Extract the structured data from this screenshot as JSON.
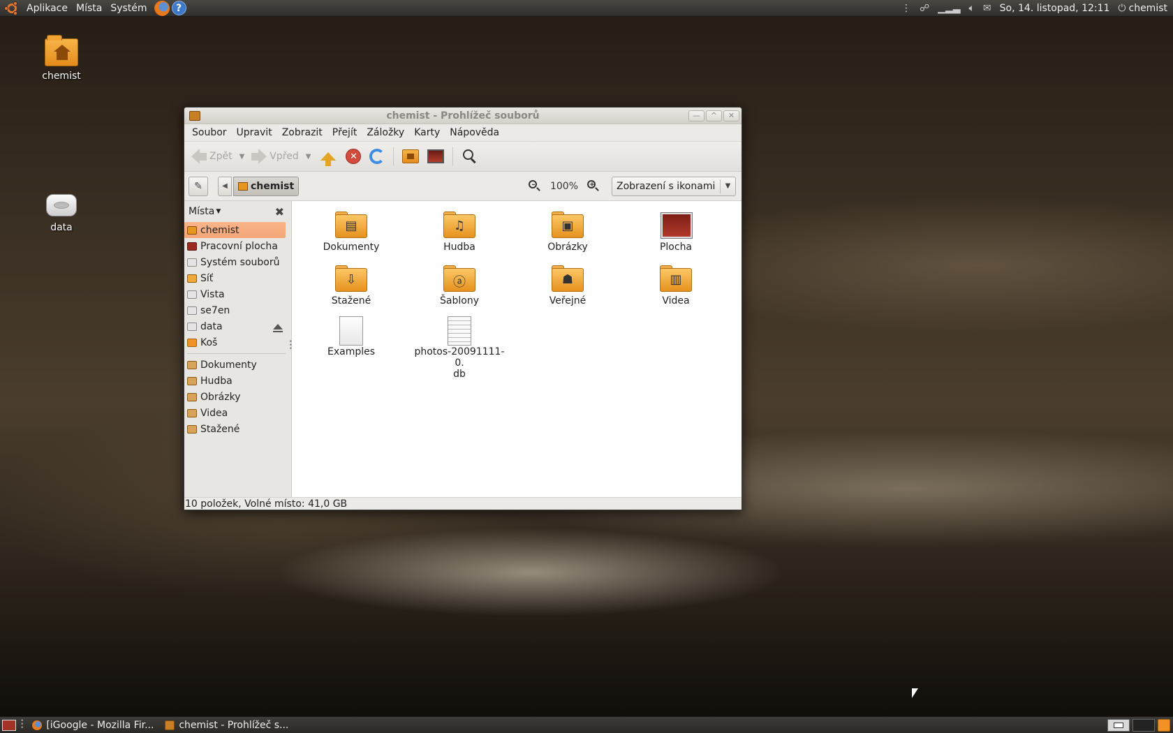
{
  "top_panel": {
    "menus": [
      "Aplikace",
      "Místa",
      "Systém"
    ],
    "clock": "So, 14. listopad, 12:11",
    "user": "chemist"
  },
  "desktop": {
    "icons": [
      {
        "label": "chemist",
        "icon": "home-folder-icon"
      },
      {
        "label": "data",
        "icon": "drive-icon"
      }
    ]
  },
  "window": {
    "title": "chemist - Prohlížeč souborů",
    "menubar": [
      "Soubor",
      "Upravit",
      "Zobrazit",
      "Přejít",
      "Záložky",
      "Karty",
      "Nápověda"
    ],
    "toolbar": {
      "back_label": "Zpět",
      "forward_label": "Vpřed"
    },
    "location": {
      "crumb": "chemist",
      "zoom": "100%",
      "view_mode": "Zobrazení s ikonami"
    },
    "sidebar": {
      "header": "Místa",
      "places": [
        {
          "label": "chemist",
          "icon": "home-icon",
          "active": true
        },
        {
          "label": "Pracovní plocha",
          "icon": "desktop-icon"
        },
        {
          "label": "Systém souborů",
          "icon": "drive-icon"
        },
        {
          "label": "Síť",
          "icon": "network-icon"
        },
        {
          "label": "Vista",
          "icon": "drive-icon"
        },
        {
          "label": "se7en",
          "icon": "drive-icon"
        },
        {
          "label": "data",
          "icon": "drive-icon",
          "eject": true
        },
        {
          "label": "Koš",
          "icon": "trash-icon"
        }
      ],
      "bookmarks": [
        {
          "label": "Dokumenty",
          "icon": "documents-folder-icon"
        },
        {
          "label": "Hudba",
          "icon": "music-folder-icon"
        },
        {
          "label": "Obrázky",
          "icon": "pictures-folder-icon"
        },
        {
          "label": "Videa",
          "icon": "videos-folder-icon"
        },
        {
          "label": "Stažené",
          "icon": "downloads-folder-icon"
        }
      ]
    },
    "files": [
      {
        "label": "Dokumenty",
        "icon": "documents-folder-icon"
      },
      {
        "label": "Hudba",
        "icon": "music-folder-icon"
      },
      {
        "label": "Obrázky",
        "icon": "pictures-folder-icon"
      },
      {
        "label": "Plocha",
        "icon": "desktop-folder-icon"
      },
      {
        "label": "Stažené",
        "icon": "downloads-folder-icon"
      },
      {
        "label": "Šablony",
        "icon": "templates-folder-icon"
      },
      {
        "label": "Veřejné",
        "icon": "public-folder-icon"
      },
      {
        "label": "Videa",
        "icon": "videos-folder-icon"
      },
      {
        "label": "Examples",
        "icon": "empty-file-icon"
      },
      {
        "label": "photos-20091111-0.",
        "label2": "db",
        "icon": "text-file-icon"
      }
    ],
    "status": "10 položek, Volné místo: 41,0 GB"
  },
  "bottom_panel": {
    "tasks": [
      {
        "label": "[iGoogle - Mozilla Fir...",
        "icon": "firefox-icon"
      },
      {
        "label": "chemist - Prohlížeč s...",
        "icon": "file-manager-icon"
      }
    ]
  }
}
